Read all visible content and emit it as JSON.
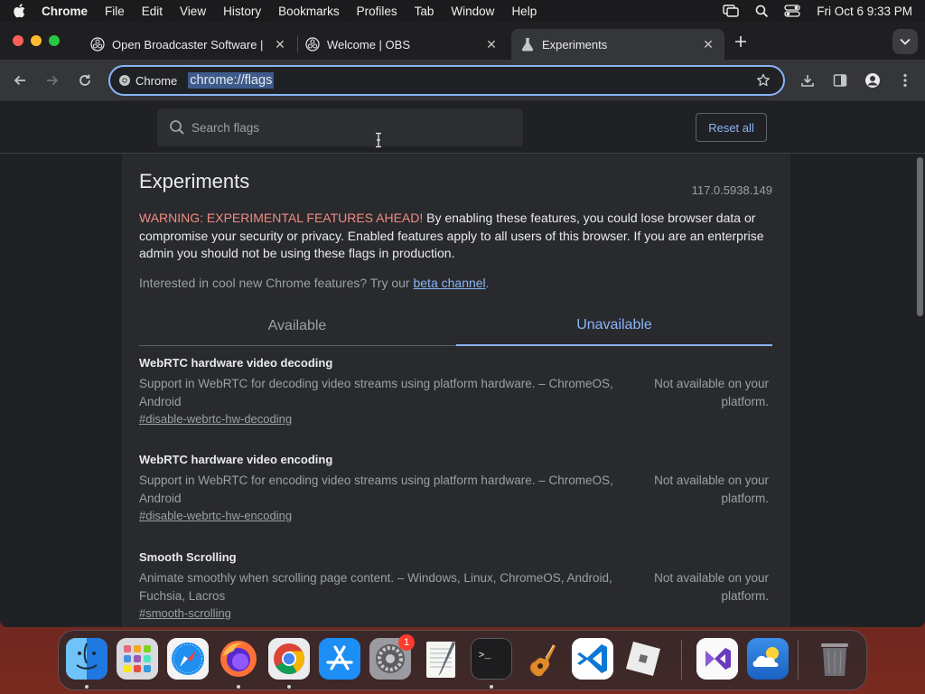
{
  "menubar": {
    "app_name": "Chrome",
    "items": [
      "File",
      "Edit",
      "View",
      "History",
      "Bookmarks",
      "Profiles",
      "Tab",
      "Window",
      "Help"
    ],
    "clock": "Fri Oct 6  9:33 PM"
  },
  "tabs": [
    {
      "title": "Open Broadcaster Software | ",
      "icon": "obs-icon",
      "active": false
    },
    {
      "title": "Welcome | OBS",
      "icon": "obs-icon",
      "active": false
    },
    {
      "title": "Experiments",
      "icon": "flask-icon",
      "active": true
    }
  ],
  "omnibox": {
    "chip_label": "Chrome",
    "url": "chrome://flags"
  },
  "flags_page": {
    "search_placeholder": "Search flags",
    "reset_label": "Reset all",
    "title": "Experiments",
    "version": "117.0.5938.149",
    "warning_strong": "WARNING: EXPERIMENTAL FEATURES AHEAD!",
    "warning_text": " By enabling these features, you could lose browser data or compromise your security or privacy. Enabled features apply to all users of this browser. If you are an enterprise admin you should not be using these flags in production.",
    "interest_text": "Interested in cool new Chrome features? Try our ",
    "interest_link": "beta channel",
    "interest_end": ".",
    "tab_available": "Available",
    "tab_unavailable": "Unavailable",
    "active_tab": "Unavailable",
    "flags": [
      {
        "name": "WebRTC hardware video decoding",
        "description": "Support in WebRTC for decoding video streams using platform hardware. – ChromeOS, Android",
        "link": "#disable-webrtc-hw-decoding",
        "status": "Not available on your platform."
      },
      {
        "name": "WebRTC hardware video encoding",
        "description": "Support in WebRTC for encoding video streams using platform hardware. – ChromeOS, Android",
        "link": "#disable-webrtc-hw-encoding",
        "status": "Not available on your platform."
      },
      {
        "name": "Smooth Scrolling",
        "description": "Animate smoothly when scrolling page content. – Windows, Linux, ChromeOS, Android, Fuchsia, Lacros",
        "link": "#smooth-scrolling",
        "status": "Not available on your platform."
      }
    ]
  },
  "dock": {
    "apps": [
      "finder",
      "launchpad",
      "safari",
      "firefox",
      "chrome",
      "app-store",
      "system-settings",
      "textedit",
      "terminal",
      "garageband",
      "vscode",
      "roblox",
      "visual-studio",
      "weather",
      "trash"
    ],
    "settings_badge": "1"
  },
  "colors": {
    "accent": "#8ab4f8",
    "warning": "#f28b82",
    "page_bg": "#202124",
    "panel_bg": "#292a2d"
  }
}
